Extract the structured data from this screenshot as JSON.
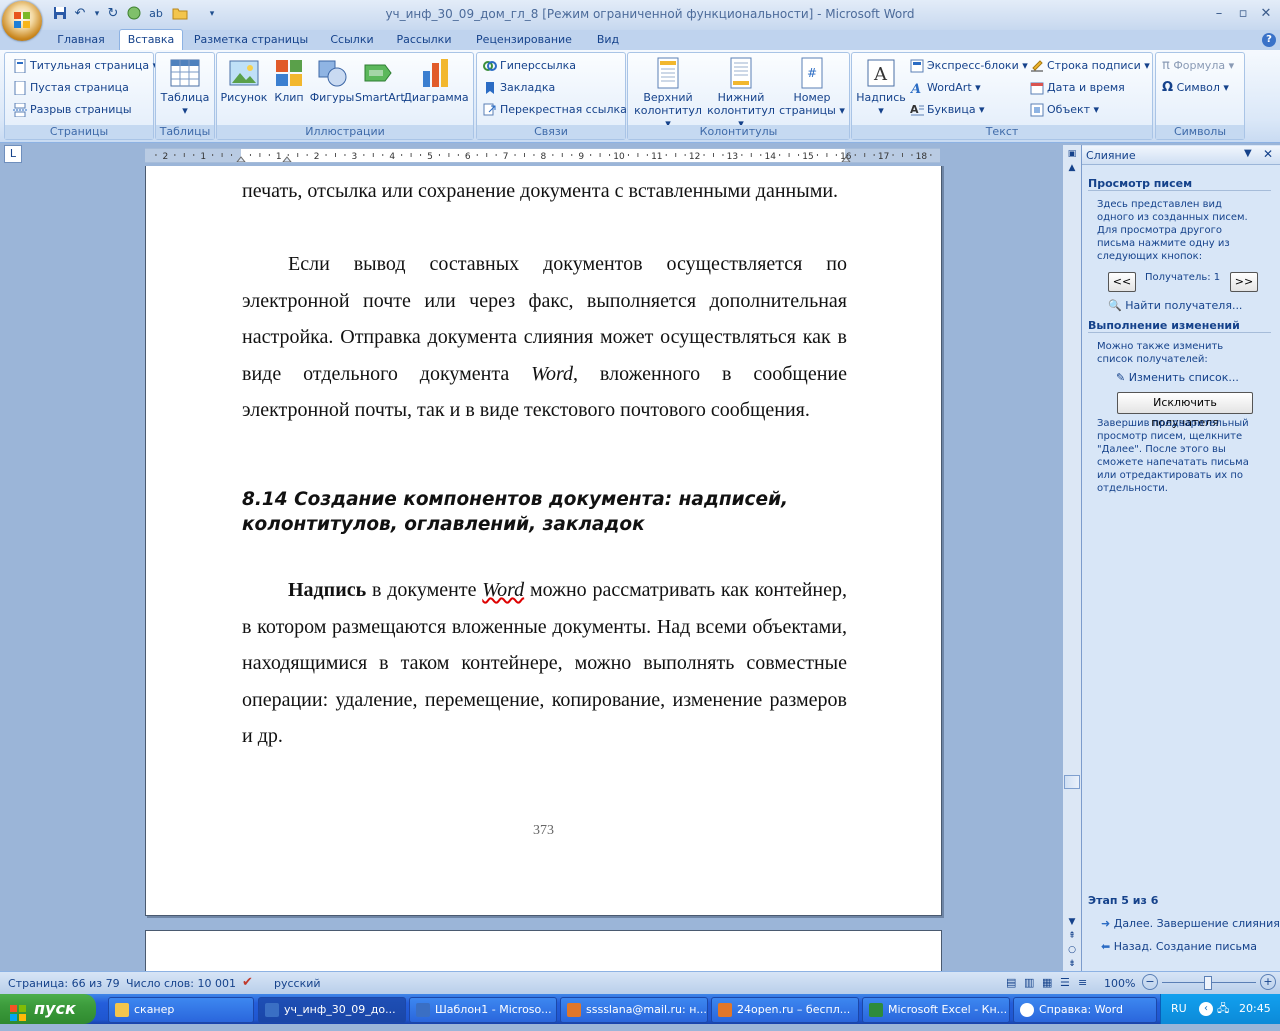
{
  "window": {
    "title": "уч_инф_30_09_дом_гл_8 [Режим ограниченной функциональности] - Microsoft Word"
  },
  "tabs": [
    "Главная",
    "Вставка",
    "Разметка страницы",
    "Ссылки",
    "Рассылки",
    "Рецензирование",
    "Вид"
  ],
  "active_tab": "Вставка",
  "ribbon": {
    "pages": {
      "label": "Страницы",
      "items": [
        "Титульная страница",
        "Пустая страница",
        "Разрыв страницы"
      ]
    },
    "tables": {
      "label": "Таблицы",
      "button": "Таблица"
    },
    "illustrations": {
      "label": "Иллюстрации",
      "buttons": [
        "Рисунок",
        "Клип",
        "Фигуры",
        "SmartArt",
        "Диаграмма"
      ]
    },
    "links": {
      "label": "Связи",
      "items": [
        "Гиперссылка",
        "Закладка",
        "Перекрестная ссылка"
      ]
    },
    "headers": {
      "label": "Колонтитулы",
      "buttons": [
        [
          "Верхний",
          "колонтитул"
        ],
        [
          "Нижний",
          "колонтитул"
        ],
        [
          "Номер",
          "страницы"
        ]
      ]
    },
    "text": {
      "label": "Текст",
      "button": "Надпись",
      "col1": [
        "Экспресс-блоки",
        "WordArt",
        "Буквица"
      ],
      "col2": [
        "Строка подписи",
        "Дата и время",
        "Объект"
      ]
    },
    "symbols": {
      "label": "Символы",
      "items": [
        "Формула",
        "Символ"
      ]
    }
  },
  "ruler": {
    "labels": [
      "2",
      "1",
      "1",
      "2",
      "3",
      "4",
      "5",
      "6",
      "7",
      "8",
      "9",
      "10",
      "11",
      "12",
      "13",
      "14",
      "15",
      "16",
      "17",
      "18"
    ]
  },
  "document": {
    "para1": "печать, отсылка или сохранение документа с вставленными данными.",
    "para2": "Если вывод составных документов осуществляется по электронной почте или через факс, выполняется дополнительная настройка. Отправка документа слияния может осуществляться как в виде отдельного документа ",
    "para2_word": "Word",
    "para2_end": ", вложенного в сообщение электронной почты, так и в виде текстового почтового сообщения.",
    "heading": "8.14 Создание компонентов документа: надписей, колонтитулов, оглавлений, закладок",
    "para3_bold": "Надпись",
    "para3_a": " в документе ",
    "para3_word": "Word",
    "para3_b": " можно рассматривать  как контейнер, в котором размещаются вложенные документы. Над всеми объектами, находящимися в таком контейнере, можно выполнять совместные операции: удаление, перемещение, копирование, изменение размеров и др.",
    "page_number": "373"
  },
  "task_pane": {
    "title": "Слияние",
    "section1": "Просмотр писем",
    "text1": "Здесь представлен вид одного из созданных писем. Для просмотра другого письма нажмите одну из следующих кнопок:",
    "prev": "<<",
    "recipient": "Получатель: 1",
    "next": ">>",
    "find": "Найти получателя...",
    "section2": "Выполнение изменений",
    "text2": "Можно также изменить список получателей:",
    "edit_list": "Изменить список...",
    "exclude": "Исключить получателя",
    "text3": "Завершив предварительный просмотр писем, щелкните \"Далее\". После этого вы сможете напечатать письма или отредактировать их по отдельности.",
    "step": "Этап 5 из 6",
    "next_step": "Далее. Завершение слияния",
    "prev_step": "Назад. Создание письма"
  },
  "status_bar": {
    "page": "Страница: 66 из 79",
    "words": "Число слов: 10 001",
    "language": "русский",
    "zoom": "100%"
  },
  "taskbar": {
    "start": "пуск",
    "tasks": [
      "сканер",
      "уч_инф_30_09_до...",
      "Шаблон1 - Microso...",
      "sssslana@mail.ru: н...",
      "24open.ru – беспл...",
      "Microsoft Excel - Кн...",
      "Справка: Word"
    ],
    "lang": "RU",
    "time": "20:45"
  },
  "colors": {
    "ribbon_text": "#15428b",
    "taskbar": "#245edb",
    "start": "#3c9b3c",
    "tray": "#0c8ad8"
  }
}
